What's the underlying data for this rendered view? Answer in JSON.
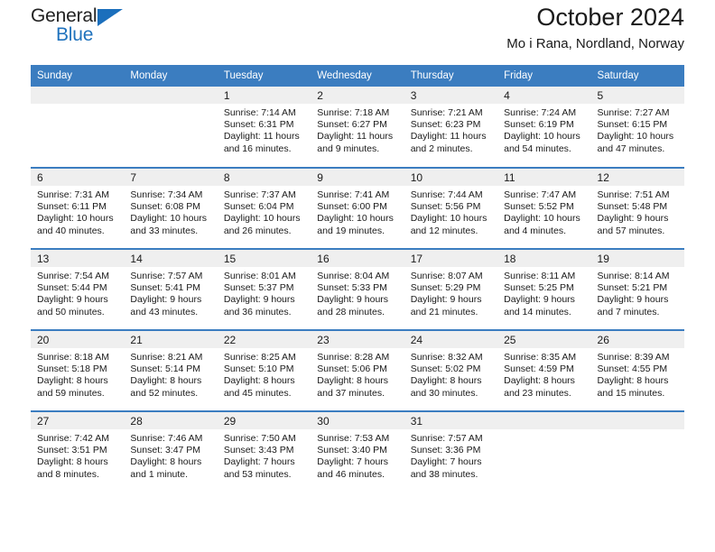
{
  "brand": {
    "name_part1": "General",
    "name_part2": "Blue",
    "triangle_color": "#1b6fbc",
    "blue_color": "#1f72bd"
  },
  "header": {
    "title": "October 2024",
    "subtitle": "Mo i Rana, Nordland, Norway"
  },
  "calendar": {
    "header_bg": "#3b7dc0",
    "daynum_bg": "#efefef",
    "weekday_headers": [
      "Sunday",
      "Monday",
      "Tuesday",
      "Wednesday",
      "Thursday",
      "Friday",
      "Saturday"
    ],
    "weeks": [
      [
        {
          "day": "",
          "lines": []
        },
        {
          "day": "",
          "lines": []
        },
        {
          "day": "1",
          "lines": [
            "Sunrise: 7:14 AM",
            "Sunset: 6:31 PM",
            "Daylight: 11 hours",
            "and 16 minutes."
          ]
        },
        {
          "day": "2",
          "lines": [
            "Sunrise: 7:18 AM",
            "Sunset: 6:27 PM",
            "Daylight: 11 hours",
            "and 9 minutes."
          ]
        },
        {
          "day": "3",
          "lines": [
            "Sunrise: 7:21 AM",
            "Sunset: 6:23 PM",
            "Daylight: 11 hours",
            "and 2 minutes."
          ]
        },
        {
          "day": "4",
          "lines": [
            "Sunrise: 7:24 AM",
            "Sunset: 6:19 PM",
            "Daylight: 10 hours",
            "and 54 minutes."
          ]
        },
        {
          "day": "5",
          "lines": [
            "Sunrise: 7:27 AM",
            "Sunset: 6:15 PM",
            "Daylight: 10 hours",
            "and 47 minutes."
          ]
        }
      ],
      [
        {
          "day": "6",
          "lines": [
            "Sunrise: 7:31 AM",
            "Sunset: 6:11 PM",
            "Daylight: 10 hours",
            "and 40 minutes."
          ]
        },
        {
          "day": "7",
          "lines": [
            "Sunrise: 7:34 AM",
            "Sunset: 6:08 PM",
            "Daylight: 10 hours",
            "and 33 minutes."
          ]
        },
        {
          "day": "8",
          "lines": [
            "Sunrise: 7:37 AM",
            "Sunset: 6:04 PM",
            "Daylight: 10 hours",
            "and 26 minutes."
          ]
        },
        {
          "day": "9",
          "lines": [
            "Sunrise: 7:41 AM",
            "Sunset: 6:00 PM",
            "Daylight: 10 hours",
            "and 19 minutes."
          ]
        },
        {
          "day": "10",
          "lines": [
            "Sunrise: 7:44 AM",
            "Sunset: 5:56 PM",
            "Daylight: 10 hours",
            "and 12 minutes."
          ]
        },
        {
          "day": "11",
          "lines": [
            "Sunrise: 7:47 AM",
            "Sunset: 5:52 PM",
            "Daylight: 10 hours",
            "and 4 minutes."
          ]
        },
        {
          "day": "12",
          "lines": [
            "Sunrise: 7:51 AM",
            "Sunset: 5:48 PM",
            "Daylight: 9 hours",
            "and 57 minutes."
          ]
        }
      ],
      [
        {
          "day": "13",
          "lines": [
            "Sunrise: 7:54 AM",
            "Sunset: 5:44 PM",
            "Daylight: 9 hours",
            "and 50 minutes."
          ]
        },
        {
          "day": "14",
          "lines": [
            "Sunrise: 7:57 AM",
            "Sunset: 5:41 PM",
            "Daylight: 9 hours",
            "and 43 minutes."
          ]
        },
        {
          "day": "15",
          "lines": [
            "Sunrise: 8:01 AM",
            "Sunset: 5:37 PM",
            "Daylight: 9 hours",
            "and 36 minutes."
          ]
        },
        {
          "day": "16",
          "lines": [
            "Sunrise: 8:04 AM",
            "Sunset: 5:33 PM",
            "Daylight: 9 hours",
            "and 28 minutes."
          ]
        },
        {
          "day": "17",
          "lines": [
            "Sunrise: 8:07 AM",
            "Sunset: 5:29 PM",
            "Daylight: 9 hours",
            "and 21 minutes."
          ]
        },
        {
          "day": "18",
          "lines": [
            "Sunrise: 8:11 AM",
            "Sunset: 5:25 PM",
            "Daylight: 9 hours",
            "and 14 minutes."
          ]
        },
        {
          "day": "19",
          "lines": [
            "Sunrise: 8:14 AM",
            "Sunset: 5:21 PM",
            "Daylight: 9 hours",
            "and 7 minutes."
          ]
        }
      ],
      [
        {
          "day": "20",
          "lines": [
            "Sunrise: 8:18 AM",
            "Sunset: 5:18 PM",
            "Daylight: 8 hours",
            "and 59 minutes."
          ]
        },
        {
          "day": "21",
          "lines": [
            "Sunrise: 8:21 AM",
            "Sunset: 5:14 PM",
            "Daylight: 8 hours",
            "and 52 minutes."
          ]
        },
        {
          "day": "22",
          "lines": [
            "Sunrise: 8:25 AM",
            "Sunset: 5:10 PM",
            "Daylight: 8 hours",
            "and 45 minutes."
          ]
        },
        {
          "day": "23",
          "lines": [
            "Sunrise: 8:28 AM",
            "Sunset: 5:06 PM",
            "Daylight: 8 hours",
            "and 37 minutes."
          ]
        },
        {
          "day": "24",
          "lines": [
            "Sunrise: 8:32 AM",
            "Sunset: 5:02 PM",
            "Daylight: 8 hours",
            "and 30 minutes."
          ]
        },
        {
          "day": "25",
          "lines": [
            "Sunrise: 8:35 AM",
            "Sunset: 4:59 PM",
            "Daylight: 8 hours",
            "and 23 minutes."
          ]
        },
        {
          "day": "26",
          "lines": [
            "Sunrise: 8:39 AM",
            "Sunset: 4:55 PM",
            "Daylight: 8 hours",
            "and 15 minutes."
          ]
        }
      ],
      [
        {
          "day": "27",
          "lines": [
            "Sunrise: 7:42 AM",
            "Sunset: 3:51 PM",
            "Daylight: 8 hours",
            "and 8 minutes."
          ]
        },
        {
          "day": "28",
          "lines": [
            "Sunrise: 7:46 AM",
            "Sunset: 3:47 PM",
            "Daylight: 8 hours",
            "and 1 minute."
          ]
        },
        {
          "day": "29",
          "lines": [
            "Sunrise: 7:50 AM",
            "Sunset: 3:43 PM",
            "Daylight: 7 hours",
            "and 53 minutes."
          ]
        },
        {
          "day": "30",
          "lines": [
            "Sunrise: 7:53 AM",
            "Sunset: 3:40 PM",
            "Daylight: 7 hours",
            "and 46 minutes."
          ]
        },
        {
          "day": "31",
          "lines": [
            "Sunrise: 7:57 AM",
            "Sunset: 3:36 PM",
            "Daylight: 7 hours",
            "and 38 minutes."
          ]
        },
        {
          "day": "",
          "lines": []
        },
        {
          "day": "",
          "lines": []
        }
      ]
    ]
  }
}
